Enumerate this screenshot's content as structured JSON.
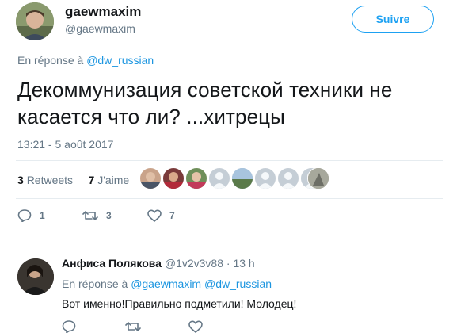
{
  "tweet": {
    "author_name": "gaewmaxim",
    "author_handle": "@gaewmaxim",
    "follow_label": "Suivre",
    "reply_prefix": "En réponse à",
    "reply_to": "@dw_russian",
    "text_line1": "Декоммунизация советской техники не",
    "text_line2": "касается что ли? ...хитрецы",
    "timestamp": "13:21 - 5 août 2017",
    "retweets_count": "3",
    "retweets_label": "Retweets",
    "likes_count": "7",
    "likes_label": "J'aime",
    "actions": {
      "reply_count": "1",
      "retweet_count": "3",
      "like_count": "7"
    },
    "likers": [
      "avatar-1",
      "avatar-2",
      "avatar-3",
      "avatar-4",
      "avatar-5",
      "avatar-6",
      "avatar-7",
      "avatar-8",
      "avatar-9"
    ]
  },
  "reply": {
    "author_name": "Анфиса Полякова",
    "author_handle": "@1v2v3v88",
    "age": "13 h",
    "separator": "·",
    "reply_prefix": "En réponse à",
    "reply_to_1": "@gaewmaxim",
    "reply_to_2": "@dw_russian",
    "text": "Вот именно!Правильно подметили! Молодец!"
  },
  "colors": {
    "accent": "#1da1f2",
    "muted": "#657786",
    "text": "#14171a",
    "divider": "#e6ecf0"
  }
}
